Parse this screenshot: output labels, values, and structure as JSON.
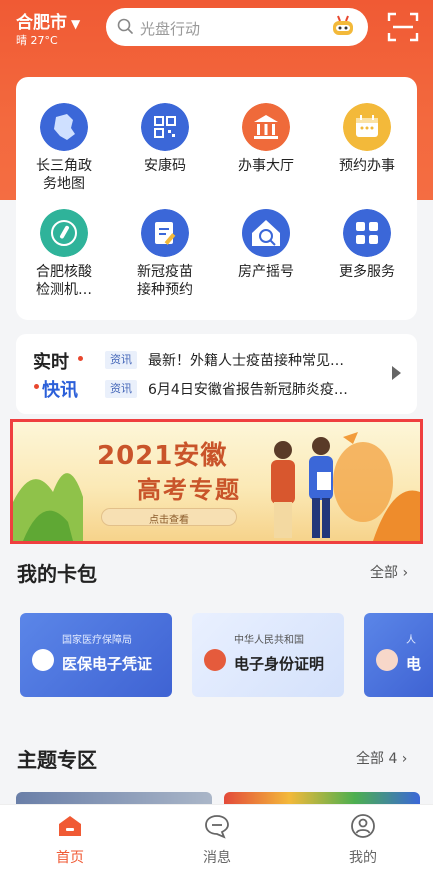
{
  "header": {
    "city": "合肥市",
    "weather": "晴 27°C",
    "search_placeholder": "光盘行动"
  },
  "services": [
    {
      "label": "长三角政务地图",
      "line1": "长三角政",
      "line2": "务地图",
      "icon": "map-icon",
      "color": "#3b67d8"
    },
    {
      "label": "安康码",
      "line1": "安康码",
      "line2": "",
      "icon": "qr-code-icon",
      "color": "#3b67d8"
    },
    {
      "label": "办事大厅",
      "line1": "办事大厅",
      "line2": "",
      "icon": "bank-building-icon",
      "color": "#ef6a3a"
    },
    {
      "label": "预约办事",
      "line1": "预约办事",
      "line2": "",
      "icon": "calendar-icon",
      "color": "#f3b93a"
    },
    {
      "label": "合肥核酸检测机…",
      "line1": "合肥核酸",
      "line2": "检测机…",
      "icon": "test-tube-icon",
      "color": "#2fb39a"
    },
    {
      "label": "新冠疫苗接种预约",
      "line1": "新冠疫苗",
      "line2": "接种预约",
      "icon": "vaccine-form-icon",
      "color": "#3b67d8"
    },
    {
      "label": "房产摇号",
      "line1": "房产摇号",
      "line2": "",
      "icon": "house-lottery-icon",
      "color": "#3b67d8"
    },
    {
      "label": "更多服务",
      "line1": "更多服务",
      "line2": "",
      "icon": "grid-more-icon",
      "color": "#3b67d8"
    }
  ],
  "news": {
    "brand_line1": "实时",
    "brand_line2": "快讯",
    "items": [
      {
        "tag": "资讯",
        "text": "最新！外籍人士疫苗接种常见…"
      },
      {
        "tag": "资讯",
        "text": "6月4日安徽省报告新冠肺炎疫…"
      }
    ]
  },
  "banner": {
    "title_line1": "2021安徽",
    "title_line2": "高考专题",
    "cta": "点击查看"
  },
  "wallet": {
    "title": "我的卡包",
    "more": "全部",
    "cards": [
      {
        "issuer": "国家医疗保障局",
        "name": "医保电子凭证"
      },
      {
        "issuer": "中华人民共和国",
        "name": "电子身份证明"
      },
      {
        "issuer": "人",
        "name": "电"
      }
    ]
  },
  "topics": {
    "title": "主题专区",
    "more": "全部 4"
  },
  "tabbar": [
    {
      "label": "首页",
      "icon": "home-icon",
      "active": true
    },
    {
      "label": "消息",
      "icon": "message-icon",
      "active": false
    },
    {
      "label": "我的",
      "icon": "profile-icon",
      "active": false
    }
  ],
  "colors": {
    "brand_orange": "#f05a34",
    "blue": "#3b67d8",
    "highlight_border": "#ef3f3f"
  }
}
